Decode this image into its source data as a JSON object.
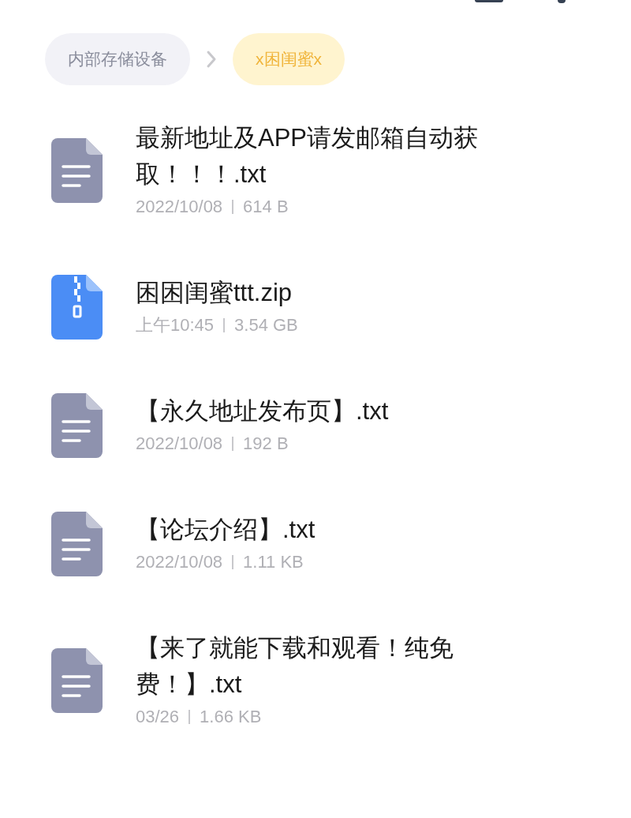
{
  "breadcrumb": [
    {
      "label": "内部存储设备",
      "selected": false
    },
    {
      "label": "x困闺蜜x",
      "selected": true
    }
  ],
  "files": [
    {
      "kind": "text",
      "name": "最新地址及APP请发邮箱自动获取！！！.txt",
      "date": "2022/10/08",
      "size": "614 B"
    },
    {
      "kind": "zip",
      "name": "困困闺蜜ttt.zip",
      "date": "上午10:45",
      "size": "3.54 GB"
    },
    {
      "kind": "text",
      "name": "【永久地址发布页】.txt",
      "date": "2022/10/08",
      "size": "192 B"
    },
    {
      "kind": "text",
      "name": "【论坛介绍】.txt",
      "date": "2022/10/08",
      "size": "1.11 KB"
    },
    {
      "kind": "text",
      "name": "【来了就能下载和观看！纯免费！】.txt",
      "date": "03/26",
      "size": "1.66 KB"
    }
  ]
}
